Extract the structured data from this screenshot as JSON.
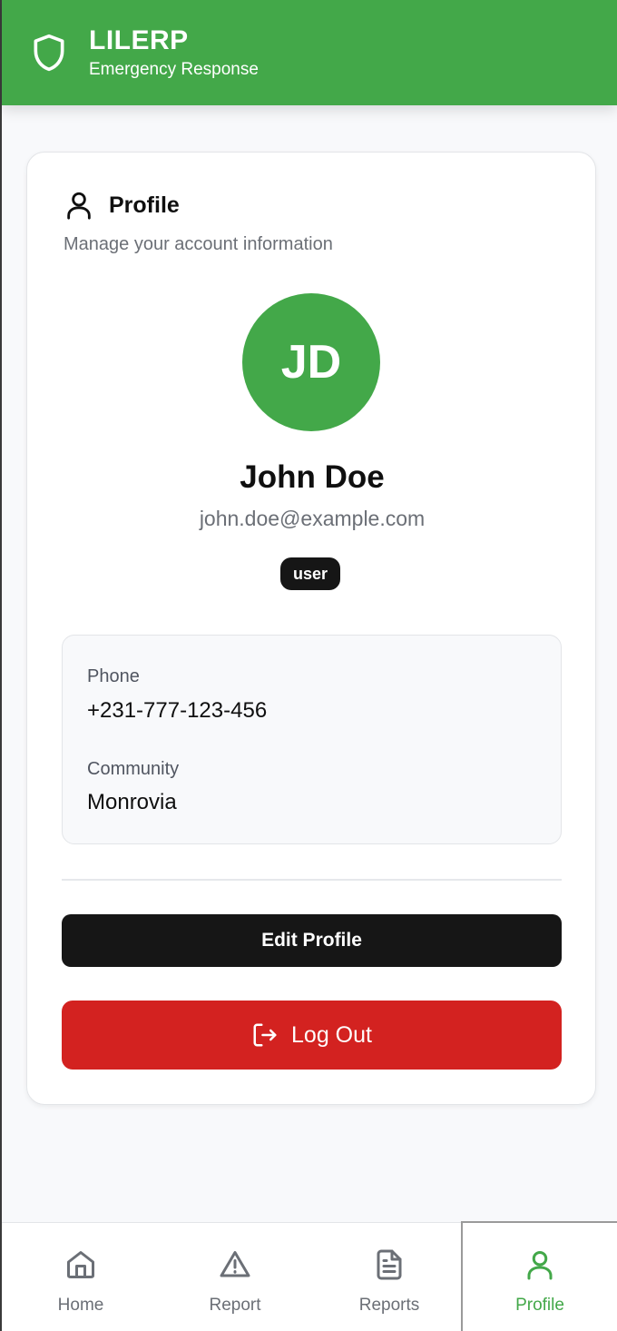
{
  "header": {
    "app_title": "LILERP",
    "app_subtitle": "Emergency Response"
  },
  "profile_card": {
    "title": "Profile",
    "description": "Manage your account information",
    "avatar_initials": "JD",
    "name": "John Doe",
    "email": "john.doe@example.com",
    "role": "user",
    "phone_label": "Phone",
    "phone_value": "+231-777-123-456",
    "community_label": "Community",
    "community_value": "Monrovia",
    "edit_button": "Edit Profile",
    "logout_button": "Log Out"
  },
  "bottom_nav": {
    "items": [
      {
        "label": "Home",
        "icon": "home-icon"
      },
      {
        "label": "Report",
        "icon": "alert-triangle-icon"
      },
      {
        "label": "Reports",
        "icon": "file-text-icon"
      },
      {
        "label": "Profile",
        "icon": "user-icon",
        "active": true
      }
    ]
  },
  "colors": {
    "brand_green": "#43a849",
    "danger_red": "#d32220",
    "dark": "#161616"
  }
}
